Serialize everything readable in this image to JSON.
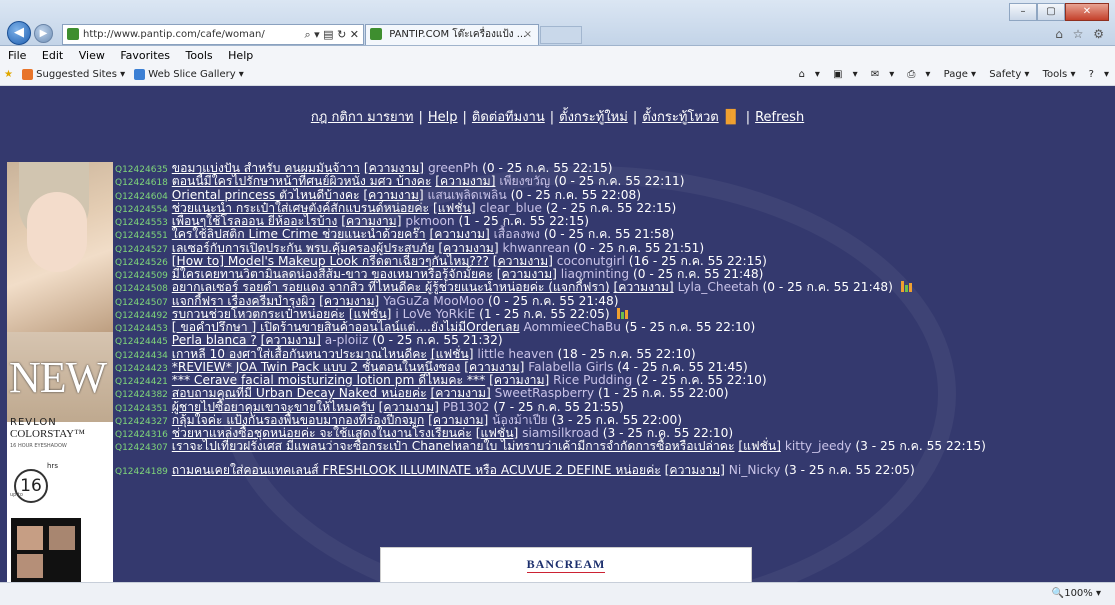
{
  "browser": {
    "address_url": "http://www.pantip.com/cafe/woman/",
    "address_tools": "⌕ ▾ ▤ ↻ ✕",
    "tab_title": "PANTIP.COM โต๊ะเครื่องแป้ง ...",
    "tab_close": "×",
    "window_controls": [
      "–",
      "▢",
      "✕"
    ],
    "right_icons": "⌂ ☆ ⚙"
  },
  "menu": [
    "File",
    "Edit",
    "View",
    "Favorites",
    "Tools",
    "Help"
  ],
  "favorites_bar": {
    "items": [
      "Suggested Sites ▾",
      "Web Slice Gallery ▾"
    ],
    "commands": [
      "▾",
      "▾",
      "▾",
      "▾",
      "Page ▾",
      "Safety ▾",
      "Tools ▾",
      "▾"
    ]
  },
  "top_links": [
    "กฎ กติกา มารยาท",
    "Help",
    "ติดต่อทีมงาน",
    "ตั้งกระทู้ใหม่",
    "ตั้งกระทู้โหวต",
    "Refresh"
  ],
  "ad": {
    "headline": "NEW",
    "brand": "REVLON",
    "product": "COLORSTAY™",
    "subline": "16 HOUR EYESHADOW",
    "hours": "16",
    "hrs_label": "hrs",
    "upto": "up to"
  },
  "threads": [
    {
      "id": "Q12424635",
      "title": "ขอมาแบ่งปัน สำหรับ คนผมมันจ้าาา",
      "category": "[ความงาม]",
      "user": "greenPh",
      "meta": "(0 - 25 ก.ค. 55 22:15)",
      "vote": false
    },
    {
      "id": "Q12424618",
      "title": "ตอนนี้มีใครไปรักษาหน้าที่ศนย์ผิวหนัง มศว บ้างคะ",
      "category": "[ความงาม]",
      "user": "เพียงขวัญ",
      "meta": "(0 - 25 ก.ค. 55 22:11)",
      "vote": false
    },
    {
      "id": "Q12424604",
      "title": "Oriental princess ตัวไหนดีบ้างคะ",
      "category": "[ความงาม]",
      "user": "แสนเพลิดเพลิน",
      "meta": "(0 - 25 ก.ค. 55 22:08)",
      "vote": false
    },
    {
      "id": "Q12424554",
      "title": "ช่วยแนะนำ กระเป๋าใส่เศษตังค์สักแบรนด์หน่อยค่ะ",
      "category": "[แฟชั่น]",
      "user": "clear_blue",
      "meta": "(2 - 25 ก.ค. 55 22:15)",
      "vote": false
    },
    {
      "id": "Q12424553",
      "title": "เพื่อนๆใช้โรลออน ยี่ห้ออะไรบ้าง",
      "category": "[ความงาม]",
      "user": "pkmoon",
      "meta": "(1 - 25 ก.ค. 55 22:15)",
      "vote": false
    },
    {
      "id": "Q12424551",
      "title": "ใครใช้ลิปสติก Lime Crime ช่วยแนะนำด้วยคร๊า",
      "category": "[ความงาม]",
      "user": "เสื้อลงพง",
      "meta": "(0 - 25 ก.ค. 55 21:58)",
      "vote": false
    },
    {
      "id": "Q12424527",
      "title": "เลเซอร์กับการเปิดประกัน พรบ.คุ้มครองผู้ประสบภัย",
      "category": "[ความงาม]",
      "user": "khwanrean",
      "meta": "(0 - 25 ก.ค. 55 21:51)",
      "vote": false
    },
    {
      "id": "Q12424526",
      "title": "[How to] Model's Makeup Look กรีดตาเฉี่ยวๆกันไหม???",
      "category": "[ความงาม]",
      "user": "coconutgirl",
      "meta": "(16 - 25 ก.ค. 55 22:15)",
      "vote": false
    },
    {
      "id": "Q12424509",
      "title": "มีใครเคยทานวิตามินลดน่องสีส้ม-ขาว ของเหมาหรือรู้จักมั้ยคะ",
      "category": "[ความงาม]",
      "user": "liaominting",
      "meta": "(0 - 25 ก.ค. 55 21:48)",
      "vote": false
    },
    {
      "id": "Q12424508",
      "title": "อยากเลเซอร์ รอยดำ รอยแดง จากสิว ที่ไหนดีคะ ผู้รู้ช่วยแนะนำหน่อยค่ะ (แจกกี้ฟรา)",
      "category": "[ความงาม]",
      "user": "Lyla_Cheetah",
      "meta": "(0 - 25 ก.ค. 55 21:48)",
      "vote": true
    },
    {
      "id": "Q12424507",
      "title": "แจกกี้ฟรา เรื่องครีมบำรุงผิว",
      "category": "[ความงาม]",
      "user": "YaGuZa MooMoo",
      "meta": "(0 - 25 ก.ค. 55 21:48)",
      "vote": false
    },
    {
      "id": "Q12424492",
      "title": "รบกวนช่วยโหวตกระเป๋าหน่อยค่ะ",
      "category": "[แฟชั่น]",
      "user": "i LoVe YoRkiE",
      "meta": "(1 - 25 ก.ค. 55 22:05)",
      "vote": true
    },
    {
      "id": "Q12424453",
      "title": "[ ขอคำปรึกษา ] เปิดร้านขายสินค้าออนไลน์แต่....ยังไม่มีOrderเลย",
      "category": "",
      "user": "AommieeChaBu",
      "meta": "(5 - 25 ก.ค. 55 22:10)",
      "vote": false
    },
    {
      "id": "Q12424445",
      "title": "Perla blanca ?",
      "category": "[ความงาม]",
      "user": "a-ploiiz",
      "meta": "(0 - 25 ก.ค. 55 21:32)",
      "vote": false
    },
    {
      "id": "Q12424434",
      "title": "เกาหลี 10 องศาใส่เสื้อกันหนาวประมาณไหนดีคะ",
      "category": "[แฟชั่น]",
      "user": "little heaven",
      "meta": "(18 - 25 ก.ค. 55 22:10)",
      "vote": false
    },
    {
      "id": "Q12424423",
      "title": "*REVIEW* JOA Twin Pack แบบ 2 ชั้นตอนในหนึ่งซอง",
      "category": "[ความงาม]",
      "user": "Falabella Girls",
      "meta": "(4 - 25 ก.ค. 55 21:45)",
      "vote": false
    },
    {
      "id": "Q12424421",
      "title": "*** Cerave facial moisturizing lotion pm ดีไหมคะ ***",
      "category": "[ความงาม]",
      "user": "Rice Pudding",
      "meta": "(2 - 25 ก.ค. 55 22:10)",
      "vote": false
    },
    {
      "id": "Q12424382",
      "title": "สอบถามคุณที่มี Urban Decay Naked หน่อยค่ะ",
      "category": "[ความงาม]",
      "user": "SweetRaspberry",
      "meta": "(1 - 25 ก.ค. 55 22:00)",
      "vote": false
    },
    {
      "id": "Q12424351",
      "title": "ผู้ชายไปซื้อยาคุมเขาจะขายให้ไหมครับ",
      "category": "[ความงาม]",
      "user": "PB1302",
      "meta": "(7 - 25 ก.ค. 55 21:55)",
      "vote": false
    },
    {
      "id": "Q12424327",
      "title": "กลุ้มใจค่ะ แป้งกันรองพื้นขอบมากองที่ร่องปีกจมูก",
      "category": "[ความงาม]",
      "user": "น้องม้าเปีย",
      "meta": "(3 - 25 ก.ค. 55 22:00)",
      "vote": false
    },
    {
      "id": "Q12424316",
      "title": "ช่วยหาแหล่งซื้อชุดหน่อยค่ะ จะใช้แสดงในงานโรงเรียนค่ะ",
      "category": "[แฟชั่น]",
      "user": "siamsilkroad",
      "meta": "(3 - 25 ก.ค. 55 22:10)",
      "vote": false
    },
    {
      "id": "Q12424307",
      "title": "เราจะไปเที่ยวฝรั่งเศส มีแพลนว่าจะซื้อกระเป๋า Chanelหลายใบ ไม่ทราบว่าเค้ามีการจำกัดการซื้อหรือเปล่าคะ",
      "category": "[แฟชั่น]",
      "user": "kitty_jeedy",
      "meta": "(3 - 25 ก.ค. 55 22:15)",
      "vote": false
    },
    {
      "id": "Q12424189",
      "title": "ถามคนเคยใส่คอนแทคเลนส์ FRESHLOOK ILLUMINATE หรือ ACUVUE 2 DEFINE หน่อยค่ะ",
      "category": "[ความงาม]",
      "user": "Ni_Nicky",
      "meta": "(3 - 25 ก.ค. 55 22:05)",
      "vote": false
    }
  ],
  "banner_text": "BANCREAM",
  "status": {
    "zoom": "🔍100%  ▾"
  },
  "colors": {
    "page_bg": "#34396e",
    "thread_id": "#7fd67a",
    "link": "#ffffff",
    "user": "#c9c3e8",
    "vote_orange": "#f0a030",
    "vote_green": "#6cc04a"
  }
}
